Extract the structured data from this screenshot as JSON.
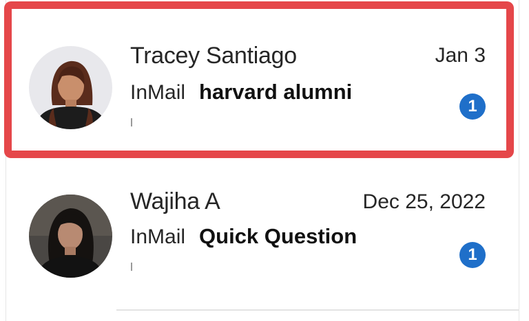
{
  "conversations": [
    {
      "name": "Tracey Santiago",
      "date": "Jan 3",
      "type": "InMail",
      "subject": "harvard alumni",
      "unread": "1",
      "highlighted": true
    },
    {
      "name": "Wajiha A",
      "date": "Dec 25, 2022",
      "type": "InMail",
      "subject": "Quick Question",
      "unread": "1",
      "highlighted": false
    }
  ],
  "colors": {
    "highlight": "#e5474a",
    "badge": "#1f6fc9",
    "text": "#262626"
  }
}
